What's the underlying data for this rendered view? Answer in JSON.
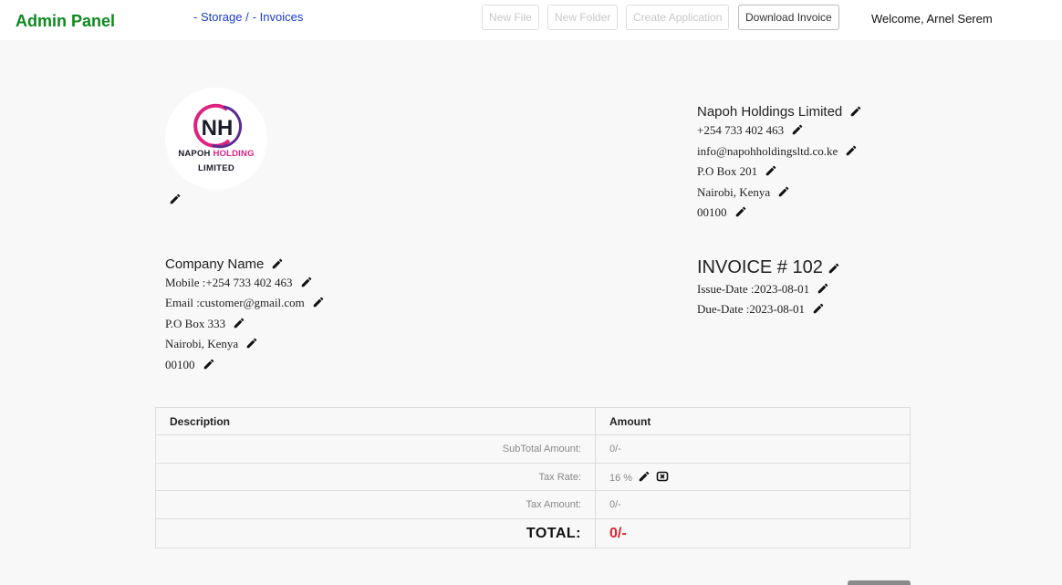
{
  "header": {
    "brand": "Admin Panel",
    "breadcrumb": [
      "- Storage /",
      "- Invoices"
    ],
    "buttons": {
      "new_file": "New File",
      "new_folder": "New Folder",
      "create_application": "Create Application",
      "download_invoice": "Download Invoice"
    },
    "welcome": "Welcome, Arnel Serem"
  },
  "logo": {
    "monogram": "NH",
    "line1_a": "NAPOH",
    "line1_b": "HOLDING",
    "line2": "LIMITED"
  },
  "issuer": {
    "name": "Napoh Holdings Limited",
    "phone": "+254 733 402 463",
    "email": "info@napohholdingsltd.co.ke",
    "pobox": "P.O Box 201",
    "city": "Nairobi, Kenya",
    "postal": "00100"
  },
  "customer": {
    "name": "Company Name",
    "mobile": "Mobile :+254 733 402 463",
    "email": "Email :customer@gmail.com",
    "pobox": "P.O Box 333",
    "city": "Nairobi, Kenya",
    "postal": "00100"
  },
  "invoice": {
    "title": "INVOICE # 102",
    "issue_date": "Issue-Date :2023-08-01",
    "due_date": "Due-Date :2023-08-01"
  },
  "table": {
    "headers": [
      "Description",
      "Amount"
    ],
    "subtotal_label": "SubTotal Amount:",
    "subtotal_value": "0/-",
    "tax_rate_label": "Tax Rate:",
    "tax_rate_value": "16 %",
    "tax_amount_label": "Tax Amount:",
    "tax_amount_value": "0/-",
    "total_label": "TOTAL:",
    "total_value": "0/-"
  },
  "colors": {
    "brand": "#0b8a1e",
    "link": "#1a3bd1",
    "total": "#d9262e",
    "logo_magenta": "#e0217f",
    "logo_purple": "#5a2d91"
  },
  "icons": {
    "edit": "pencil-icon",
    "remove": "cancel-box-icon"
  }
}
